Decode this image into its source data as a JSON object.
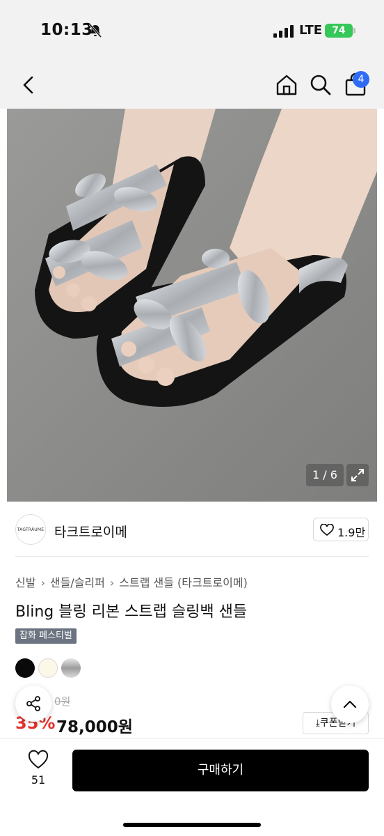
{
  "status_bar": {
    "time": "10:13",
    "network": "LTE",
    "battery": "74"
  },
  "header": {
    "cart_count": "4"
  },
  "gallery": {
    "counter": "1 / 6"
  },
  "brand": {
    "logo_text": "TAGTRÄUME",
    "name": "타크트로이메",
    "likes": "1.9만"
  },
  "breadcrumb": [
    "신발",
    "샌들/슬리퍼",
    "스트랩 샌들 (타크트로이메)"
  ],
  "product": {
    "title": "Bling 블링 리본 스트랩 슬링백 샌들",
    "tag": "잡화 페스티벌",
    "swatch_colors": [
      "#0a0a0a",
      "#fbf8e8",
      "#b0b0b0"
    ],
    "original_price": "0원",
    "discount": "35%",
    "sale_price": "78,000원",
    "coupon_label": "쿠폰받기"
  },
  "bottom_bar": {
    "wish_count": "51",
    "buy_label": "구매하기"
  },
  "colors": {
    "accent_blue": "#2f6bf5",
    "discount_red": "#e5322d",
    "tag_gray": "#6b7480",
    "battery_green": "#35c759"
  }
}
